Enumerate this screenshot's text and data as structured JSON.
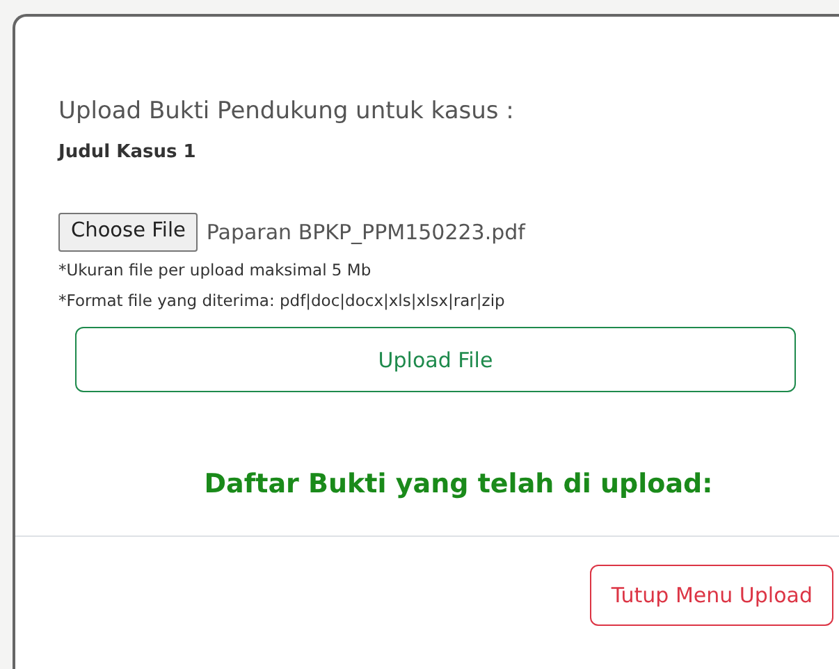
{
  "dialog": {
    "title": "Upload Bukti Pendukung untuk kasus :",
    "case_title": "Judul Kasus 1",
    "file_picker": {
      "button": "Choose File",
      "file_name": "Paparan BPKP_PPM150223.pdf"
    },
    "hints": [
      "*Ukuran file per upload maksimal 5 Mb",
      "*Format file yang diterima: pdf|doc|docx|xls|xlsx|rar|zip"
    ],
    "upload_button": "Upload File",
    "list_heading": "Daftar Bukti yang telah di upload:",
    "footer_buttons": [
      "Tutup Menu Upload"
    ]
  }
}
